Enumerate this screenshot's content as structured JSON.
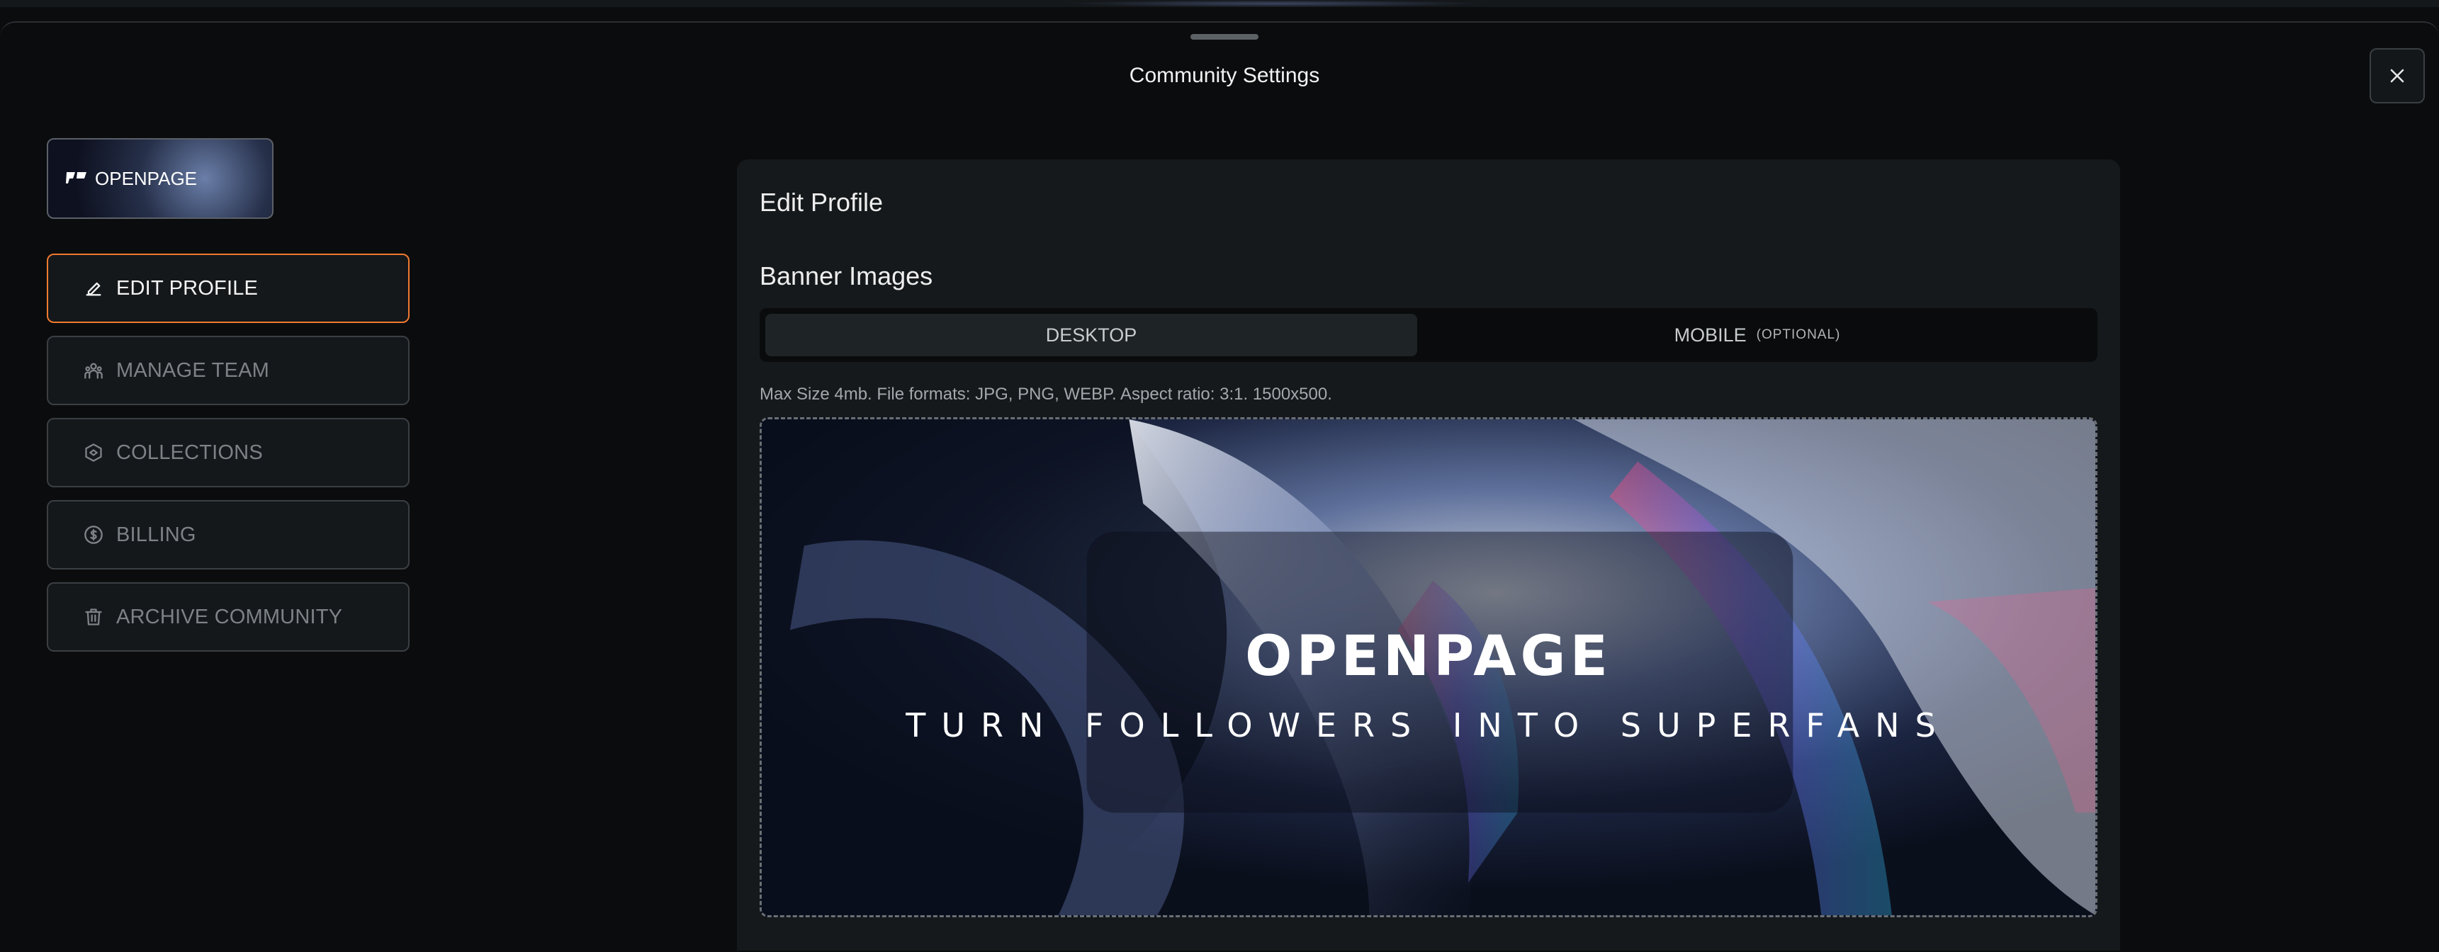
{
  "modal": {
    "title": "Community Settings",
    "close_icon": "close-icon"
  },
  "sidebar": {
    "thumb_logo_text": "OPENPAGE",
    "items": [
      {
        "label": "EDIT PROFILE",
        "icon": "pencil-icon",
        "active": true
      },
      {
        "label": "MANAGE TEAM",
        "icon": "team-icon",
        "active": false
      },
      {
        "label": "COLLECTIONS",
        "icon": "collections-icon",
        "active": false
      },
      {
        "label": "BILLING",
        "icon": "dollar-icon",
        "active": false
      },
      {
        "label": "ARCHIVE COMMUNITY",
        "icon": "trash-icon",
        "active": false
      }
    ]
  },
  "main": {
    "title": "Edit Profile",
    "banner_section": {
      "title": "Banner Images",
      "tabs": [
        {
          "label": "DESKTOP",
          "selected": true
        },
        {
          "label": "MOBILE",
          "suffix": "(OPTIONAL)",
          "selected": false
        }
      ],
      "hint": "Max Size 4mb. File formats: JPG, PNG, WEBP. Aspect ratio: 3:1. 1500x500.",
      "banner_brand": "OPENPAGE",
      "banner_tagline": "TURN FOLLOWERS INTO SUPERFANS"
    }
  },
  "colors": {
    "accent": "#f07a30",
    "background": "#0b0c0d",
    "panel": "#15191b"
  }
}
